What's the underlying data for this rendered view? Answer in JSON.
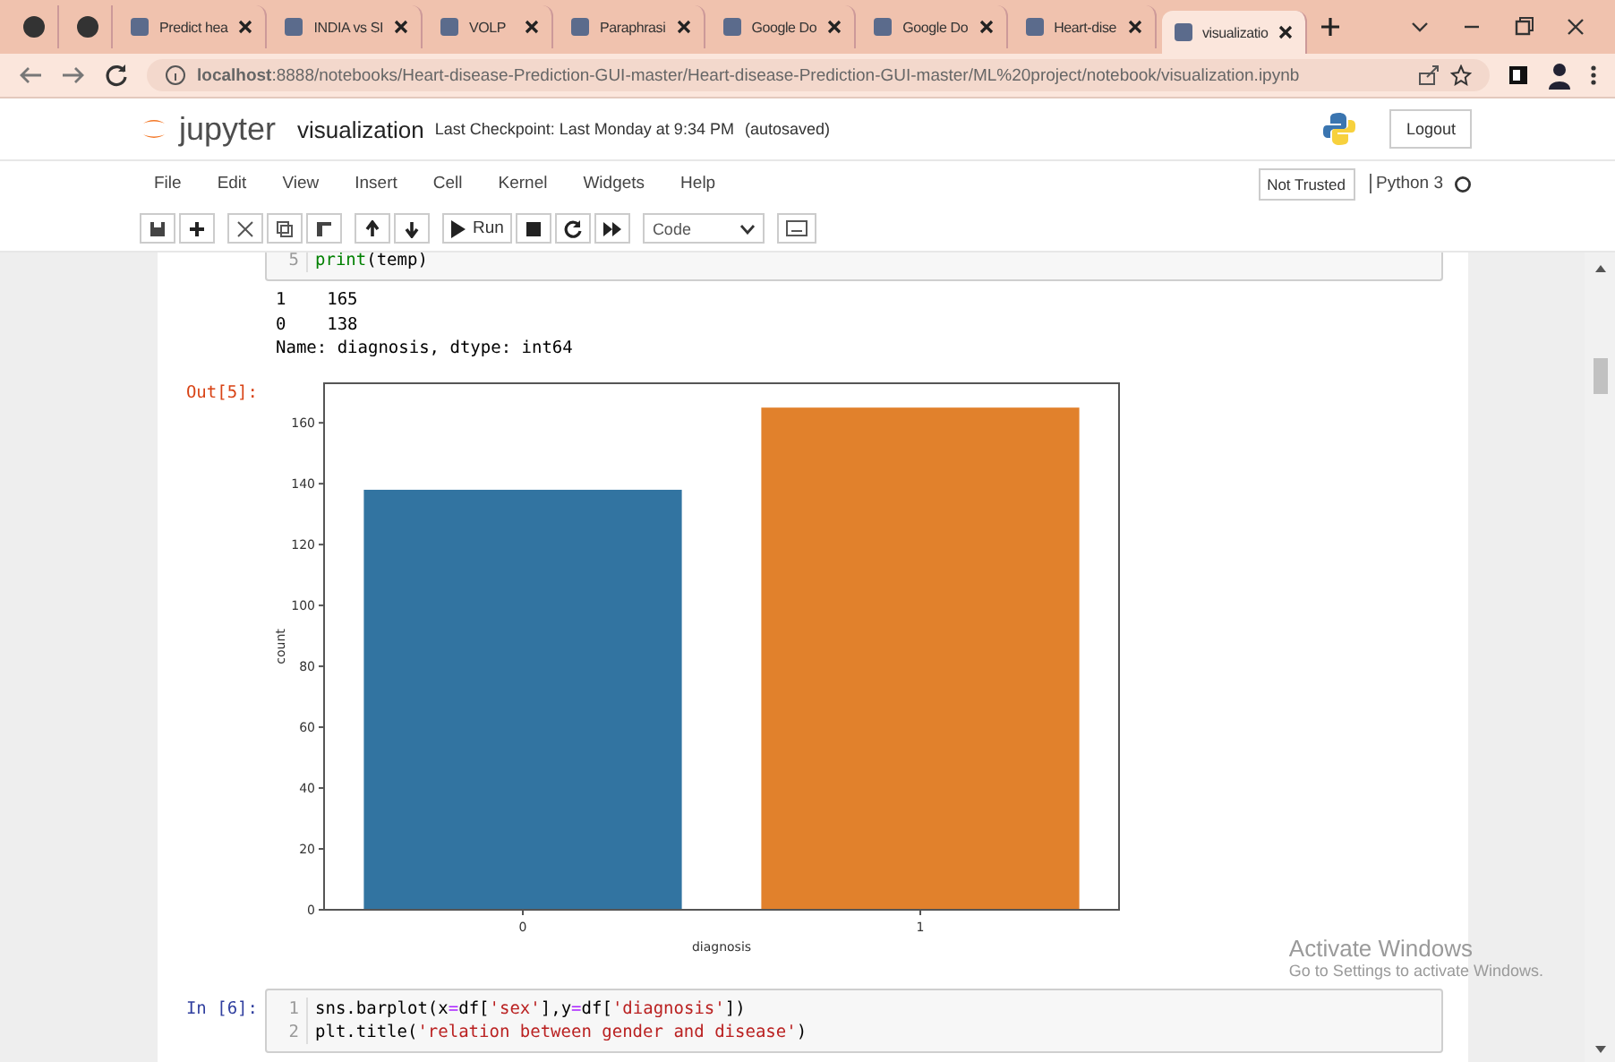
{
  "browser": {
    "tabs": [
      {
        "kind": "pinned",
        "selected": false
      },
      {
        "kind": "pinned",
        "selected": false
      },
      {
        "kind": "page",
        "title": "Predict hea",
        "selected": false
      },
      {
        "kind": "page",
        "title": "INDIA vs SI",
        "selected": false
      },
      {
        "kind": "page",
        "title": "VOLP",
        "selected": false
      },
      {
        "kind": "page",
        "title": "Paraphrasi",
        "selected": false
      },
      {
        "kind": "page",
        "title": "Google Do",
        "selected": false
      },
      {
        "kind": "page",
        "title": "Google Do",
        "selected": false
      },
      {
        "kind": "page",
        "title": "Heart-dise",
        "selected": false
      },
      {
        "kind": "page",
        "title": "visualizatio",
        "selected": true
      }
    ],
    "url": "**localhost**:8888/notebooks/Heart-disease-Prediction-GUI-master/Heart-disease-Prediction-GUI-master/ML%20project/notebook/visualization.ipynb"
  },
  "jupyter": {
    "brand": "jupyter",
    "notebook_title": "visualization",
    "checkpoint": "Last Checkpoint: Last Monday at 9:34 PM",
    "autosave": "(autosaved)",
    "logout": "Logout",
    "menu": [
      "File",
      "Edit",
      "View",
      "Insert",
      "Cell",
      "Kernel",
      "Widgets",
      "Help"
    ],
    "trust": "Not Trusted",
    "kernel": "Python 3",
    "kernel_busy": false,
    "toolbar": {
      "run": "Run",
      "cell_type": "Code"
    }
  },
  "cells": [
    {
      "kind": "code",
      "lines": [
        {
          "number": "5",
          "tokens": [
            {
              "text": "print",
              "kind": "builtin"
            },
            {
              "text": "(temp)",
              "kind": "plain"
            }
          ]
        }
      ]
    },
    {
      "kind": "text_output",
      "lines": [
        "1    165",
        "0    138",
        "Name: diagnosis, dtype: int64"
      ]
    },
    {
      "kind": "chart_output",
      "prompt": "Out[5]:",
      "chart_data": {
        "type": "bar",
        "xlabel": "diagnosis",
        "ylabel": "count",
        "categories": [
          "0",
          "1"
        ],
        "values": [
          138,
          165
        ],
        "ylim": [
          0,
          173
        ],
        "yticks": [
          0,
          20,
          40,
          60,
          80,
          100,
          120,
          140,
          160
        ]
      }
    },
    {
      "kind": "code",
      "prompt": "In [6]:",
      "lines": [
        {
          "number": "1",
          "tokens": [
            {
              "text": "sns.barplot(x",
              "kind": "plain"
            },
            {
              "text": "=",
              "kind": "op"
            },
            {
              "text": "df[",
              "kind": "plain"
            },
            {
              "text": "'sex'",
              "kind": "string"
            },
            {
              "text": "],y",
              "kind": "plain"
            },
            {
              "text": "=",
              "kind": "op"
            },
            {
              "text": "df[",
              "kind": "plain"
            },
            {
              "text": "'diagnosis'",
              "kind": "string"
            },
            {
              "text": "])",
              "kind": "plain"
            }
          ]
        },
        {
          "number": "2",
          "tokens": [
            {
              "text": "plt.title(",
              "kind": "plain"
            },
            {
              "text": "'relation between gender and disease'",
              "kind": "string"
            },
            {
              "text": ")",
              "kind": "plain"
            }
          ]
        }
      ]
    }
  ],
  "os_notice": {
    "title": "Activate Windows",
    "subtitle": "Go to Settings to activate Windows."
  }
}
